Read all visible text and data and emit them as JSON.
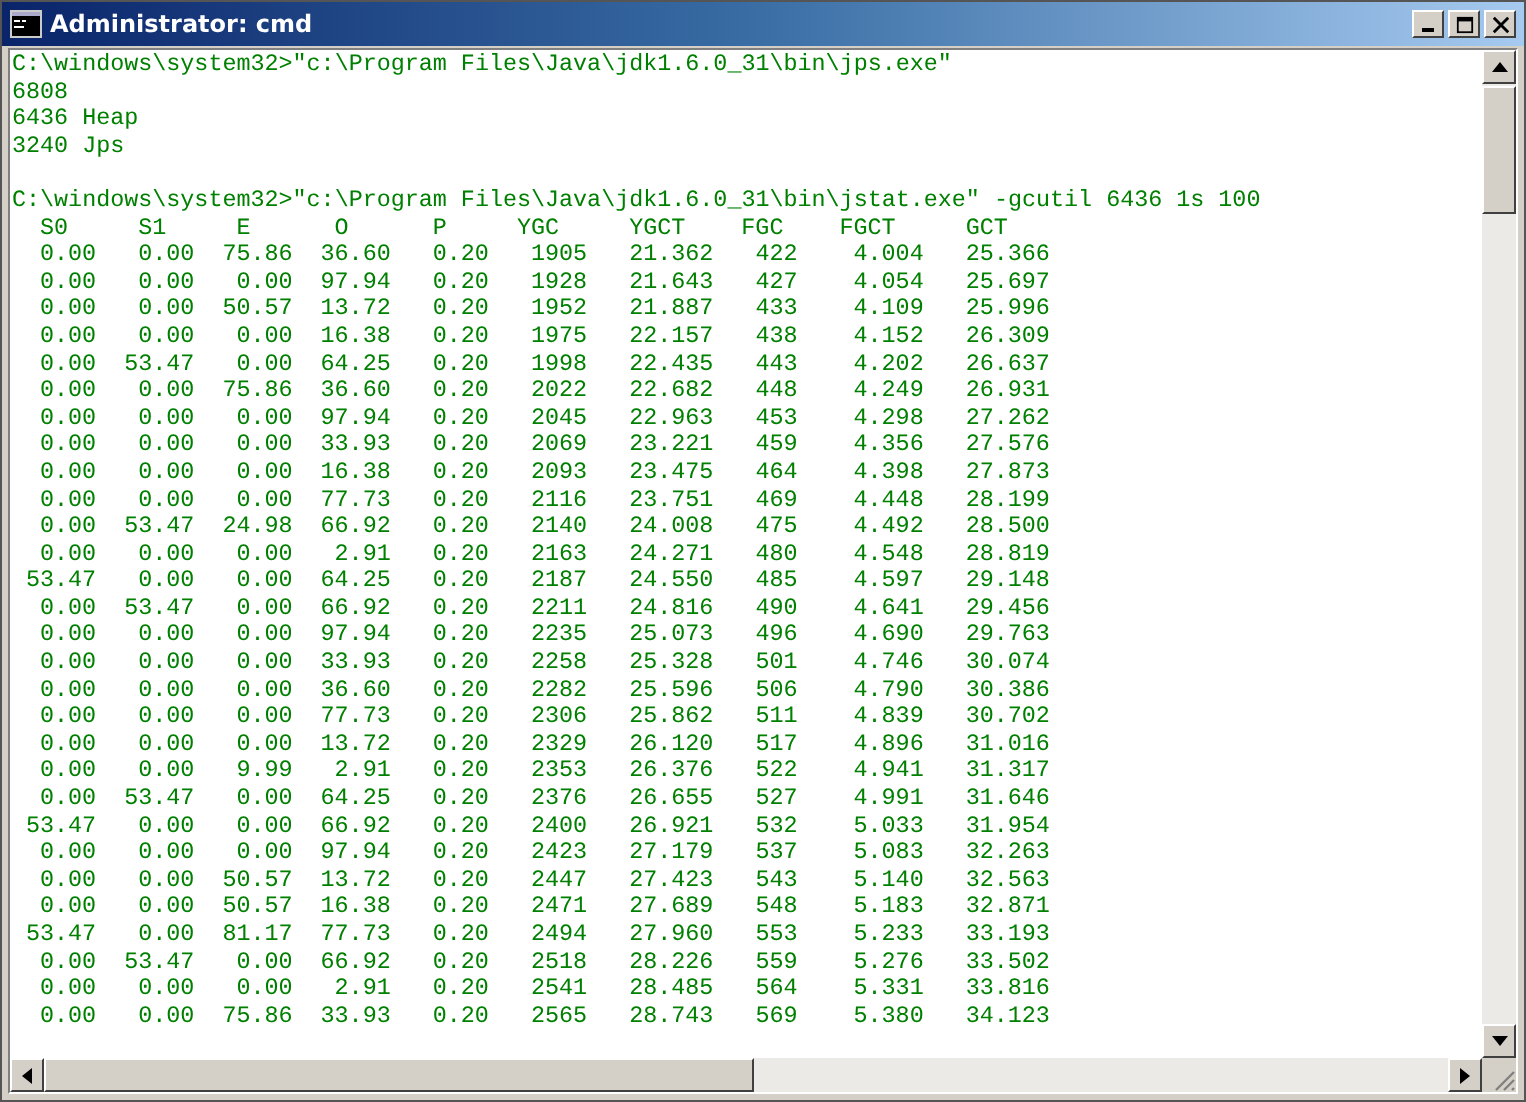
{
  "window": {
    "title": "Administrator: cmd"
  },
  "console": {
    "jps_lines": [
      "C:\\windows\\system32>\"c:\\Program Files\\Java\\jdk1.6.0_31\\bin\\jps.exe\"",
      "6808",
      "6436 Heap",
      "3240 Jps"
    ],
    "jstat_command": "C:\\windows\\system32>\"c:\\Program Files\\Java\\jdk1.6.0_31\\bin\\jstat.exe\" -gcutil 6436 1s 100",
    "table": {
      "columns": [
        "S0",
        "S1",
        "E",
        "O",
        "P",
        "YGC",
        "YGCT",
        "FGC",
        "FGCT",
        "GCT"
      ],
      "rows": [
        [
          "0.00",
          "0.00",
          "75.86",
          "36.60",
          "0.20",
          "1905",
          "21.362",
          "422",
          "4.004",
          "25.366"
        ],
        [
          "0.00",
          "0.00",
          "0.00",
          "97.94",
          "0.20",
          "1928",
          "21.643",
          "427",
          "4.054",
          "25.697"
        ],
        [
          "0.00",
          "0.00",
          "50.57",
          "13.72",
          "0.20",
          "1952",
          "21.887",
          "433",
          "4.109",
          "25.996"
        ],
        [
          "0.00",
          "0.00",
          "0.00",
          "16.38",
          "0.20",
          "1975",
          "22.157",
          "438",
          "4.152",
          "26.309"
        ],
        [
          "0.00",
          "53.47",
          "0.00",
          "64.25",
          "0.20",
          "1998",
          "22.435",
          "443",
          "4.202",
          "26.637"
        ],
        [
          "0.00",
          "0.00",
          "75.86",
          "36.60",
          "0.20",
          "2022",
          "22.682",
          "448",
          "4.249",
          "26.931"
        ],
        [
          "0.00",
          "0.00",
          "0.00",
          "97.94",
          "0.20",
          "2045",
          "22.963",
          "453",
          "4.298",
          "27.262"
        ],
        [
          "0.00",
          "0.00",
          "0.00",
          "33.93",
          "0.20",
          "2069",
          "23.221",
          "459",
          "4.356",
          "27.576"
        ],
        [
          "0.00",
          "0.00",
          "0.00",
          "16.38",
          "0.20",
          "2093",
          "23.475",
          "464",
          "4.398",
          "27.873"
        ],
        [
          "0.00",
          "0.00",
          "0.00",
          "77.73",
          "0.20",
          "2116",
          "23.751",
          "469",
          "4.448",
          "28.199"
        ],
        [
          "0.00",
          "53.47",
          "24.98",
          "66.92",
          "0.20",
          "2140",
          "24.008",
          "475",
          "4.492",
          "28.500"
        ],
        [
          "0.00",
          "0.00",
          "0.00",
          "2.91",
          "0.20",
          "2163",
          "24.271",
          "480",
          "4.548",
          "28.819"
        ],
        [
          "53.47",
          "0.00",
          "0.00",
          "64.25",
          "0.20",
          "2187",
          "24.550",
          "485",
          "4.597",
          "29.148"
        ],
        [
          "0.00",
          "53.47",
          "0.00",
          "66.92",
          "0.20",
          "2211",
          "24.816",
          "490",
          "4.641",
          "29.456"
        ],
        [
          "0.00",
          "0.00",
          "0.00",
          "97.94",
          "0.20",
          "2235",
          "25.073",
          "496",
          "4.690",
          "29.763"
        ],
        [
          "0.00",
          "0.00",
          "0.00",
          "33.93",
          "0.20",
          "2258",
          "25.328",
          "501",
          "4.746",
          "30.074"
        ],
        [
          "0.00",
          "0.00",
          "0.00",
          "36.60",
          "0.20",
          "2282",
          "25.596",
          "506",
          "4.790",
          "30.386"
        ],
        [
          "0.00",
          "0.00",
          "0.00",
          "77.73",
          "0.20",
          "2306",
          "25.862",
          "511",
          "4.839",
          "30.702"
        ],
        [
          "0.00",
          "0.00",
          "0.00",
          "13.72",
          "0.20",
          "2329",
          "26.120",
          "517",
          "4.896",
          "31.016"
        ],
        [
          "0.00",
          "0.00",
          "9.99",
          "2.91",
          "0.20",
          "2353",
          "26.376",
          "522",
          "4.941",
          "31.317"
        ],
        [
          "0.00",
          "53.47",
          "0.00",
          "64.25",
          "0.20",
          "2376",
          "26.655",
          "527",
          "4.991",
          "31.646"
        ],
        [
          "53.47",
          "0.00",
          "0.00",
          "66.92",
          "0.20",
          "2400",
          "26.921",
          "532",
          "5.033",
          "31.954"
        ],
        [
          "0.00",
          "0.00",
          "0.00",
          "97.94",
          "0.20",
          "2423",
          "27.179",
          "537",
          "5.083",
          "32.263"
        ],
        [
          "0.00",
          "0.00",
          "50.57",
          "13.72",
          "0.20",
          "2447",
          "27.423",
          "543",
          "5.140",
          "32.563"
        ],
        [
          "0.00",
          "0.00",
          "50.57",
          "16.38",
          "0.20",
          "2471",
          "27.689",
          "548",
          "5.183",
          "32.871"
        ],
        [
          "53.47",
          "0.00",
          "81.17",
          "77.73",
          "0.20",
          "2494",
          "27.960",
          "553",
          "5.233",
          "33.193"
        ],
        [
          "0.00",
          "53.47",
          "0.00",
          "66.92",
          "0.20",
          "2518",
          "28.226",
          "559",
          "5.276",
          "33.502"
        ],
        [
          "0.00",
          "0.00",
          "0.00",
          "2.91",
          "0.20",
          "2541",
          "28.485",
          "564",
          "5.331",
          "33.816"
        ],
        [
          "0.00",
          "0.00",
          "75.86",
          "33.93",
          "0.20",
          "2565",
          "28.743",
          "569",
          "5.380",
          "34.123"
        ]
      ]
    }
  }
}
